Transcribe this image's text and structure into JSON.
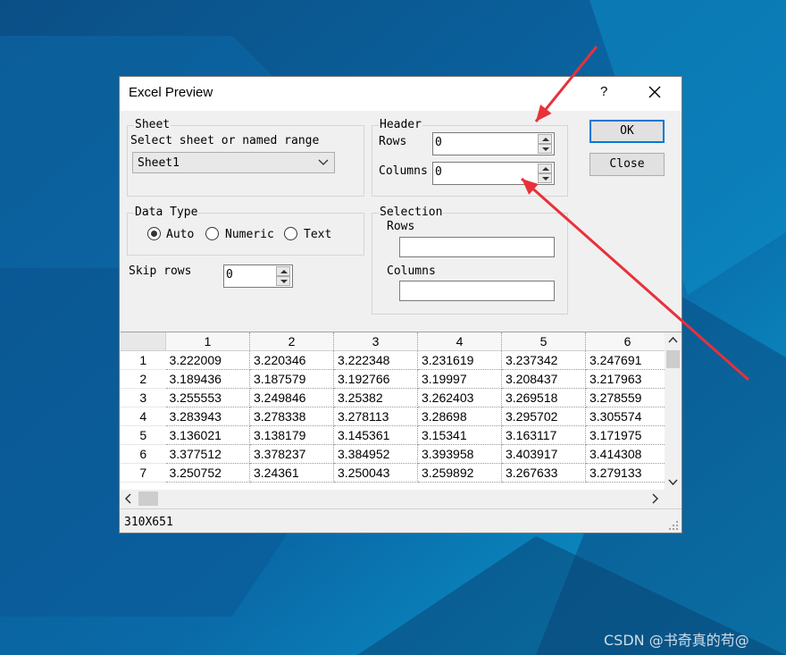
{
  "dialog": {
    "title": "Excel Preview",
    "help": "?",
    "sheet": {
      "legend": "Sheet",
      "label": "Select sheet or named range",
      "selected": "Sheet1"
    },
    "header": {
      "legend": "Header",
      "rows_label": "Rows",
      "rows_value": "0",
      "columns_label": "Columns",
      "columns_value": "0"
    },
    "data_type": {
      "legend": "Data Type",
      "options": [
        "Auto",
        "Numeric",
        "Text"
      ],
      "selected": "Auto"
    },
    "selection": {
      "legend": "Selection",
      "rows_label": "Rows",
      "columns_label": "Columns",
      "rows_value": "",
      "columns_value": ""
    },
    "skip_rows": {
      "label": "Skip rows",
      "value": "0"
    },
    "buttons": {
      "ok": "OK",
      "close": "Close"
    },
    "grid": {
      "columns": [
        "1",
        "2",
        "3",
        "4",
        "5",
        "6"
      ],
      "rows": [
        {
          "index": "1",
          "cells": [
            "3.222009",
            "3.220346",
            "3.222348",
            "3.231619",
            "3.237342",
            "3.247691"
          ]
        },
        {
          "index": "2",
          "cells": [
            "3.189436",
            "3.187579",
            "3.192766",
            "3.19997",
            "3.208437",
            "3.217963"
          ]
        },
        {
          "index": "3",
          "cells": [
            "3.255553",
            "3.249846",
            "3.25382",
            "3.262403",
            "3.269518",
            "3.278559"
          ]
        },
        {
          "index": "4",
          "cells": [
            "3.283943",
            "3.278338",
            "3.278113",
            "3.28698",
            "3.295702",
            "3.305574"
          ]
        },
        {
          "index": "5",
          "cells": [
            "3.136021",
            "3.138179",
            "3.145361",
            "3.15341",
            "3.163117",
            "3.171975"
          ]
        },
        {
          "index": "6",
          "cells": [
            "3.377512",
            "3.378237",
            "3.384952",
            "3.393958",
            "3.403917",
            "3.414308"
          ]
        },
        {
          "index": "7",
          "cells": [
            "3.250752",
            "3.24361",
            "3.250043",
            "3.259892",
            "3.267633",
            "3.279133"
          ]
        }
      ]
    },
    "status": "310X651"
  },
  "watermark": "CSDN @书奇真的苟@",
  "colors": {
    "annotation_arrow": "#e8313a",
    "desktop": "#0a5d98",
    "focus": "#0078d7"
  }
}
